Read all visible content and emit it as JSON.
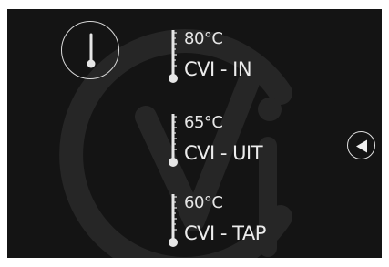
{
  "readings": [
    {
      "temperature": "80°C",
      "label": "CVI - IN"
    },
    {
      "temperature": "65°C",
      "label": "CVI - UIT"
    },
    {
      "temperature": "60°C",
      "label": "CVI - TAP"
    }
  ],
  "icons": {
    "header": "thermometer-icon",
    "reading": "thermometer-icon",
    "navigation": "triangle-left-icon",
    "background": "cvi-logo-watermark"
  },
  "colors": {
    "background": "#141414",
    "foreground": "#e6e6e6",
    "watermark": "#2a2a2a"
  }
}
